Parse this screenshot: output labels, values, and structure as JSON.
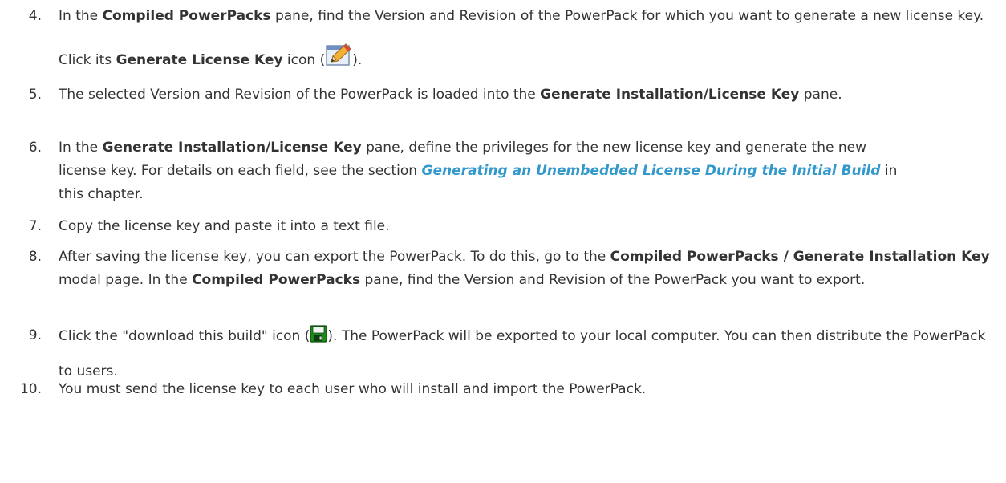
{
  "steps": [
    {
      "number": "4.",
      "parts": [
        {
          "t": "In the ",
          "s": "n"
        },
        {
          "t": "Compiled PowerPacks",
          "s": "b"
        },
        {
          "t": " pane, find the Version and Revision of the PowerPack for which you want to generate a new license key. Click its ",
          "s": "n"
        },
        {
          "t": "Generate License Key",
          "s": "b"
        },
        {
          "t": " icon (",
          "s": "n"
        },
        {
          "icon": "pencil-edit-icon"
        },
        {
          "t": ").",
          "s": "n"
        }
      ]
    },
    {
      "number": "5.",
      "parts": [
        {
          "t": "The selected Version and Revision of the PowerPack is loaded into the ",
          "s": "n"
        },
        {
          "t": "Generate Installation/License Key",
          "s": "b"
        },
        {
          "t": " pane.",
          "s": "n"
        }
      ]
    },
    {
      "number": "6.",
      "parts": [
        {
          "t": "In the ",
          "s": "n"
        },
        {
          "t": "Generate Installation/License Key",
          "s": "b"
        },
        {
          "t": " pane, define the privileges for the new license key and generate the new license key. For details on each field, see the section ",
          "s": "n"
        },
        {
          "t": "Generating an Unembedded License During the Initial Build",
          "s": "link"
        },
        {
          "t": " in this chapter.",
          "s": "n"
        }
      ]
    },
    {
      "number": "7.",
      "parts": [
        {
          "t": "Copy the license key and paste it into a text file.",
          "s": "n"
        }
      ]
    },
    {
      "number": "8.",
      "parts": [
        {
          "t": "After saving the license key, you can export the PowerPack. To do this, go to the ",
          "s": "n"
        },
        {
          "t": "Compiled PowerPacks / Generate Installation Key",
          "s": "b"
        },
        {
          "t": " modal page. In the ",
          "s": "n"
        },
        {
          "t": "Compiled PowerPacks",
          "s": "b"
        },
        {
          "t": " pane, find the Version and Revision of the PowerPack you want to export.",
          "s": "n"
        }
      ]
    },
    {
      "number": "9.",
      "parts": [
        {
          "t": "Click the \"download this build\" icon (",
          "s": "n"
        },
        {
          "icon": "save-disk-icon"
        },
        {
          "t": "). The PowerPack will be exported to your local computer. You can then distribute the PowerPack to users.",
          "s": "n"
        }
      ]
    },
    {
      "number": "10.",
      "parts": [
        {
          "t": "You must send the license key to each user who will install and import the PowerPack.",
          "s": "n"
        }
      ]
    }
  ],
  "colors": {
    "body_text": "#333333",
    "link": "#3399cc",
    "save_icon_green": "#1e8a1e",
    "pencil_icon_blue": "#1f5fbf"
  }
}
